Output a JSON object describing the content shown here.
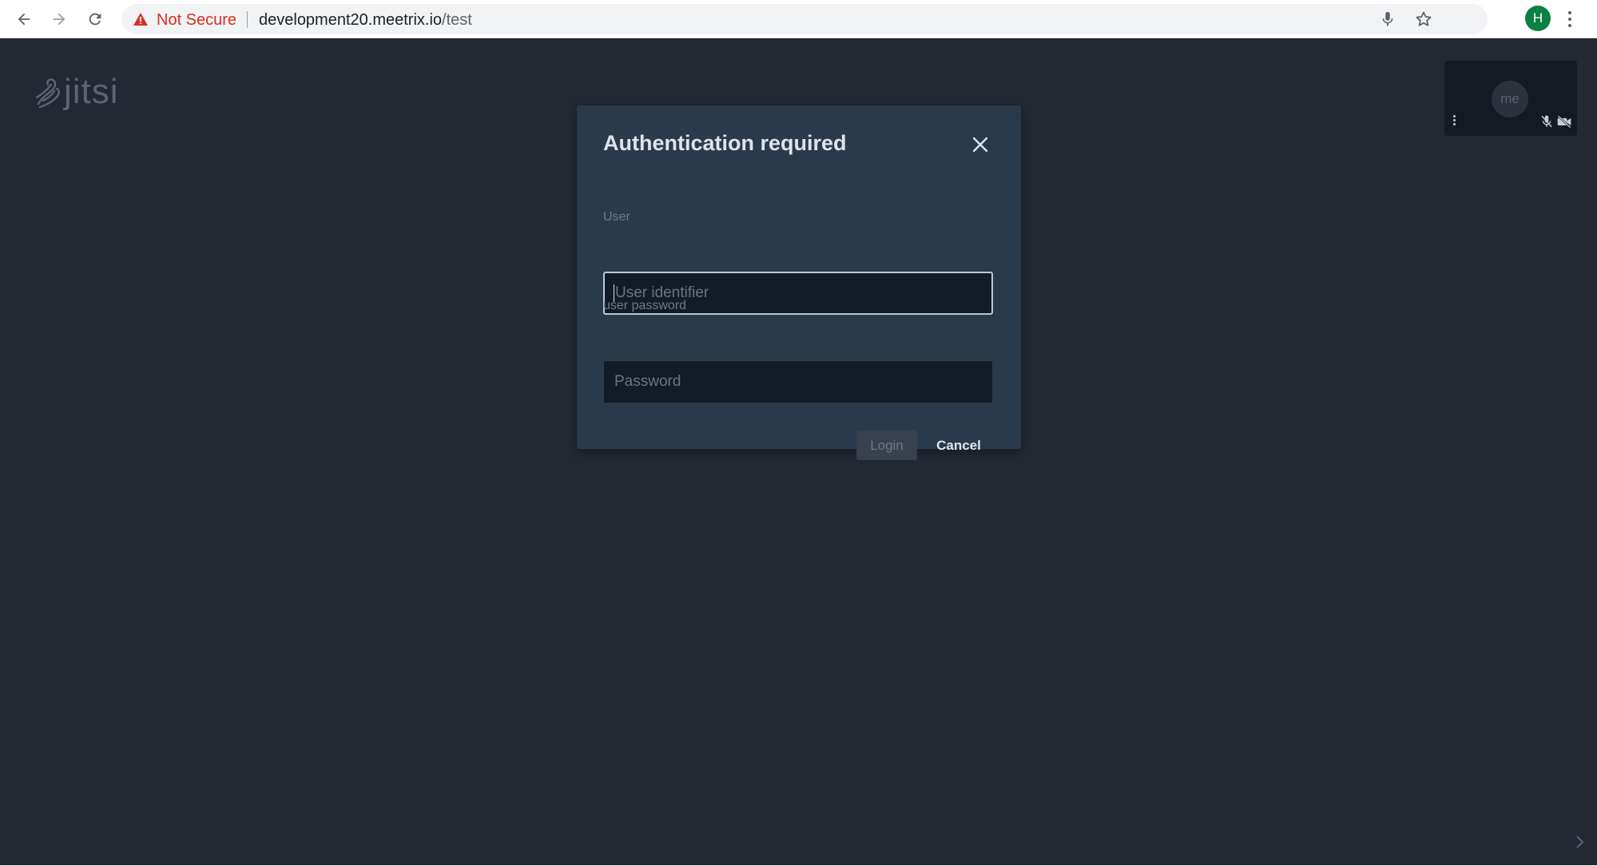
{
  "browser": {
    "security_label": "Not Secure",
    "url_host": "development20.meetrix.io",
    "url_path": "/test",
    "profile_initial": "H"
  },
  "page": {
    "logo_text": "jitsi",
    "local_participant": {
      "avatar_text": "me"
    }
  },
  "dialog": {
    "title": "Authentication required",
    "user_label": "User",
    "user_placeholder": "User identifier",
    "user_value": "",
    "password_label": "user password",
    "password_placeholder": "Password",
    "password_value": "",
    "login_label": "Login",
    "cancel_label": "Cancel"
  },
  "colors": {
    "page_background": "#232833",
    "dialog_background": "#2a3a4b",
    "not_secure": "#d93025",
    "profile": "#0b8043"
  },
  "icons": {
    "back": "arrow-left-icon",
    "forward": "arrow-right-icon",
    "reload": "reload-icon",
    "warning": "warning-triangle-icon",
    "mic": "microphone-icon",
    "bookmark": "star-icon",
    "menu": "kebab-menu-icon",
    "close": "close-icon",
    "mic_off": "mic-off-icon",
    "camera_off": "camera-off-icon",
    "expand": "chevron-right-icon"
  }
}
